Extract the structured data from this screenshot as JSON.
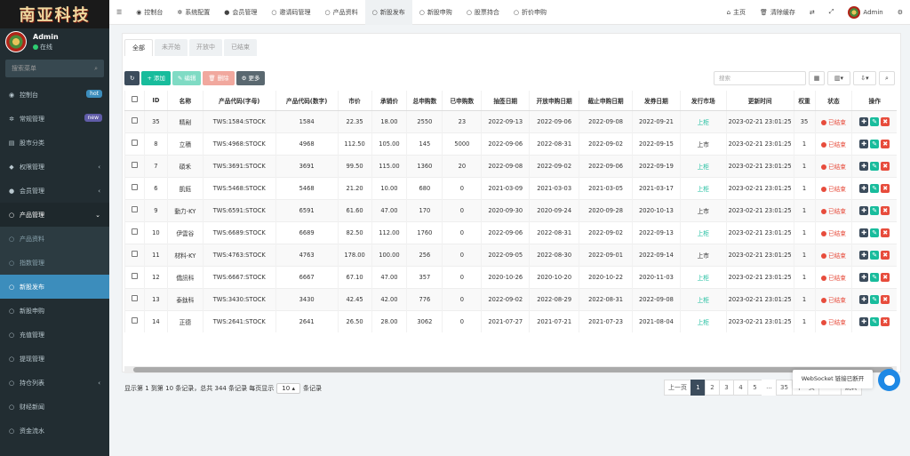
{
  "brand": {
    "logo_text": "南亚科技"
  },
  "user": {
    "name": "Admin",
    "status": "在线"
  },
  "sidebar": {
    "search_placeholder": "搜索菜单",
    "items": [
      {
        "label": "控制台",
        "badge": "hot",
        "icon": "dashboard-icon"
      },
      {
        "label": "常规管理",
        "badge": "new",
        "icon": "cog-icon"
      },
      {
        "label": "股市分类",
        "icon": "chart-icon"
      },
      {
        "label": "权限管理",
        "icon": "lock-icon"
      },
      {
        "label": "会员管理",
        "icon": "user-icon"
      },
      {
        "label": "产品管理",
        "icon": "circle-icon"
      },
      {
        "label": "产品资料",
        "icon": "circle-icon"
      },
      {
        "label": "指数管理",
        "icon": "circle-icon"
      },
      {
        "label": "新股发布",
        "icon": "circle-icon"
      },
      {
        "label": "新股申购",
        "icon": "circle-icon"
      },
      {
        "label": "充值管理",
        "icon": "circle-icon"
      },
      {
        "label": "提现管理",
        "icon": "circle-icon"
      },
      {
        "label": "持仓列表",
        "icon": "circle-icon"
      },
      {
        "label": "财经新闻",
        "icon": "circle-icon"
      },
      {
        "label": "资金流水",
        "icon": "circle-icon"
      }
    ]
  },
  "topbar": {
    "tabs": [
      {
        "label": "控制台",
        "icon": "dashboard-icon"
      },
      {
        "label": "系统配置",
        "icon": "cog-icon"
      },
      {
        "label": "会员管理",
        "icon": "user-icon"
      },
      {
        "label": "邀请码管理",
        "icon": "circle-icon"
      },
      {
        "label": "产品资料",
        "icon": "circle-icon"
      },
      {
        "label": "新股发布",
        "icon": "circle-icon"
      },
      {
        "label": "新股申购",
        "icon": "circle-icon"
      },
      {
        "label": "股票持合",
        "icon": "circle-icon"
      },
      {
        "label": "折价申购",
        "icon": "circle-icon"
      }
    ],
    "home_label": "主页",
    "clear_cache_label": "清除缓存",
    "admin_label": "Admin"
  },
  "filter_tabs": [
    "全部",
    "未开始",
    "开放中",
    "已结束"
  ],
  "toolbar": {
    "add": "添加",
    "edit": "编辑",
    "delete": "删除",
    "more": "更多",
    "search_placeholder": "搜索"
  },
  "table": {
    "headers": [
      "ID",
      "名称",
      "产品代码(字母)",
      "产品代码(数字)",
      "市价",
      "承销价",
      "总申购数",
      "已申购数",
      "抽签日期",
      "开放申购日期",
      "截止申购日期",
      "发券日期",
      "发行市场",
      "更新时间",
      "权重",
      "状态",
      "操作"
    ],
    "rows": [
      [
        "35",
        "精剐",
        "TWS:1584:STOCK",
        "1584",
        "22.35",
        "18.00",
        "2550",
        "23",
        "2022-09-13",
        "2022-09-06",
        "2022-09-08",
        "2022-09-21",
        "上柜",
        "2023-02-21 23:01:25",
        "35",
        "已结束"
      ],
      [
        "8",
        "立積",
        "TWS:4968:STOCK",
        "4968",
        "112.50",
        "105.00",
        "145",
        "5000",
        "2022-09-06",
        "2022-08-31",
        "2022-09-02",
        "2022-09-15",
        "上市",
        "2023-02-21 23:01:25",
        "1",
        "已结束"
      ],
      [
        "7",
        "碩禾",
        "TWS:3691:STOCK",
        "3691",
        "99.50",
        "115.00",
        "1360",
        "20",
        "2022-09-08",
        "2022-09-02",
        "2022-09-06",
        "2022-09-19",
        "上柜",
        "2023-02-21 23:01:25",
        "1",
        "已结束"
      ],
      [
        "6",
        "凱鈺",
        "TWS:5468:STOCK",
        "5468",
        "21.20",
        "10.00",
        "680",
        "0",
        "2021-03-09",
        "2021-03-03",
        "2021-03-05",
        "2021-03-17",
        "上柜",
        "2023-02-21 23:01:25",
        "1",
        "已结束"
      ],
      [
        "9",
        "動力-KY",
        "TWS:6591:STOCK",
        "6591",
        "61.60",
        "47.00",
        "170",
        "0",
        "2020-09-30",
        "2020-09-24",
        "2020-09-28",
        "2020-10-13",
        "上市",
        "2023-02-21 23:01:25",
        "1",
        "已结束"
      ],
      [
        "10",
        "伊雲谷",
        "TWS:6689:STOCK",
        "6689",
        "82.50",
        "112.00",
        "1760",
        "0",
        "2022-09-06",
        "2022-08-31",
        "2022-09-02",
        "2022-09-13",
        "上柜",
        "2023-02-21 23:01:25",
        "1",
        "已结束"
      ],
      [
        "11",
        "材料-KY",
        "TWS:4763:STOCK",
        "4763",
        "178.00",
        "100.00",
        "256",
        "0",
        "2022-09-05",
        "2022-08-30",
        "2022-09-01",
        "2022-09-14",
        "上市",
        "2023-02-21 23:01:25",
        "1",
        "已结束"
      ],
      [
        "12",
        "僑訊科",
        "TWS:6667:STOCK",
        "6667",
        "67.10",
        "47.00",
        "357",
        "0",
        "2020-10-26",
        "2020-10-20",
        "2020-10-22",
        "2020-11-03",
        "上柜",
        "2023-02-21 23:01:25",
        "1",
        "已结束"
      ],
      [
        "13",
        "泰鈦科",
        "TWS:3430:STOCK",
        "3430",
        "42.45",
        "42.00",
        "776",
        "0",
        "2022-09-02",
        "2022-08-29",
        "2022-08-31",
        "2022-09-08",
        "上柜",
        "2023-02-21 23:01:25",
        "1",
        "已结束"
      ],
      [
        "14",
        "正德",
        "TWS:2641:STOCK",
        "2641",
        "26.50",
        "28.00",
        "3062",
        "0",
        "2021-07-27",
        "2021-07-21",
        "2021-07-23",
        "2021-08-04",
        "上柜",
        "2023-02-21 23:01:25",
        "1",
        "已结束"
      ]
    ]
  },
  "footer": {
    "info_prefix": "显示第 1 到第 10 条记录，总共 344 条记录 每页显示",
    "per_page": "10",
    "info_suffix": "条记录"
  },
  "pagination": {
    "prev": "上一页",
    "pages": [
      "1",
      "2",
      "3",
      "4",
      "5",
      "...",
      "35"
    ],
    "next": "下一页",
    "jump": "跳转"
  },
  "toast": "WebSocket 链接已断开",
  "colors": {
    "sidebar_bg": "#222d32",
    "active_blue": "#3c8dbc",
    "add_green": "#18bc9c",
    "status_red": "#e74c3c"
  }
}
